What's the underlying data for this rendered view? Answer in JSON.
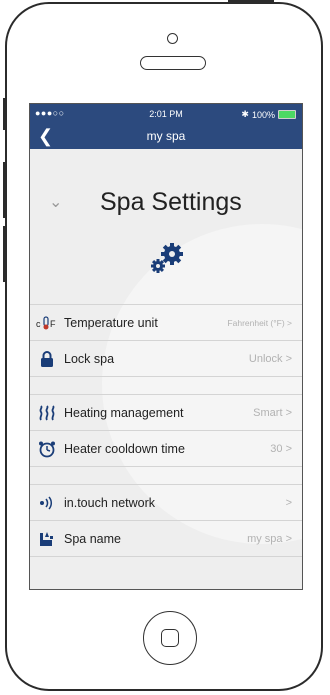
{
  "status": {
    "carrier": "●●●○○",
    "time": "2:01 PM",
    "battery": "100%",
    "bluetooth_icon": "bluetooth-icon"
  },
  "nav": {
    "back_icon": "chevron-left-icon",
    "title": "my spa"
  },
  "section": {
    "title": "Spa Settings",
    "collapse_icon": "chevron-down-icon",
    "settings_icon": "gears-icon"
  },
  "groups": [
    [
      {
        "icon": "temperature-unit-icon",
        "label": "Temperature unit",
        "value": "Fahrenheit (°F) >"
      },
      {
        "icon": "lock-icon",
        "label": "Lock spa",
        "value": "Unlock >"
      }
    ],
    [
      {
        "icon": "heating-icon",
        "label": "Heating management",
        "value": "Smart >"
      },
      {
        "icon": "timer-icon",
        "label": "Heater cooldown time",
        "value": "30 >"
      }
    ],
    [
      {
        "icon": "network-icon",
        "label": "in.touch network",
        "value": ">"
      },
      {
        "icon": "spa-name-icon",
        "label": "Spa name",
        "value": "my spa >"
      }
    ]
  ],
  "colors": {
    "navbar": "#2c4a7e",
    "icon": "#1a3d78",
    "battery": "#4cd964"
  }
}
